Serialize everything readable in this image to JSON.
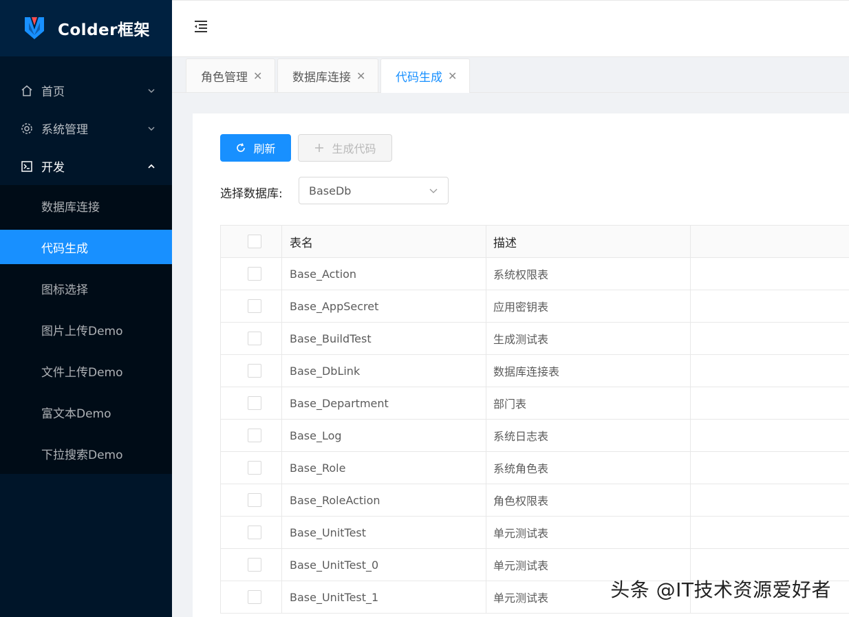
{
  "app": {
    "title": "Colder框架",
    "accent": "#1890ff",
    "sidebar_bg": "#001529"
  },
  "sidebar": {
    "items": [
      {
        "label": "首页",
        "icon": "home-icon",
        "state": "collapsed"
      },
      {
        "label": "系统管理",
        "icon": "gear-icon",
        "state": "collapsed"
      },
      {
        "label": "开发",
        "icon": "terminal-icon",
        "state": "expanded",
        "children": [
          {
            "label": "数据库连接",
            "active": false
          },
          {
            "label": "代码生成",
            "active": true
          },
          {
            "label": "图标选择",
            "active": false
          },
          {
            "label": "图片上传Demo",
            "active": false
          },
          {
            "label": "文件上传Demo",
            "active": false
          },
          {
            "label": "富文本Demo",
            "active": false
          },
          {
            "label": "下拉搜索Demo",
            "active": false
          }
        ]
      }
    ]
  },
  "tabs": [
    {
      "label": "角色管理",
      "active": false
    },
    {
      "label": "数据库连接",
      "active": false
    },
    {
      "label": "代码生成",
      "active": true
    }
  ],
  "toolbar": {
    "refresh_label": "刷新",
    "generate_label": "生成代码"
  },
  "db_select": {
    "label": "选择数据库:",
    "value": "BaseDb"
  },
  "table": {
    "columns": [
      "表名",
      "描述"
    ],
    "rows": [
      {
        "name": "Base_Action",
        "desc": "系统权限表"
      },
      {
        "name": "Base_AppSecret",
        "desc": "应用密钥表"
      },
      {
        "name": "Base_BuildTest",
        "desc": "生成测试表"
      },
      {
        "name": "Base_DbLink",
        "desc": "数据库连接表"
      },
      {
        "name": "Base_Department",
        "desc": "部门表"
      },
      {
        "name": "Base_Log",
        "desc": "系统日志表"
      },
      {
        "name": "Base_Role",
        "desc": "系统角色表"
      },
      {
        "name": "Base_RoleAction",
        "desc": "角色权限表"
      },
      {
        "name": "Base_UnitTest",
        "desc": "单元测试表"
      },
      {
        "name": "Base_UnitTest_0",
        "desc": "单元测试表"
      },
      {
        "name": "Base_UnitTest_1",
        "desc": "单元测试表"
      }
    ]
  },
  "watermark": "头条 @IT技术资源爱好者"
}
